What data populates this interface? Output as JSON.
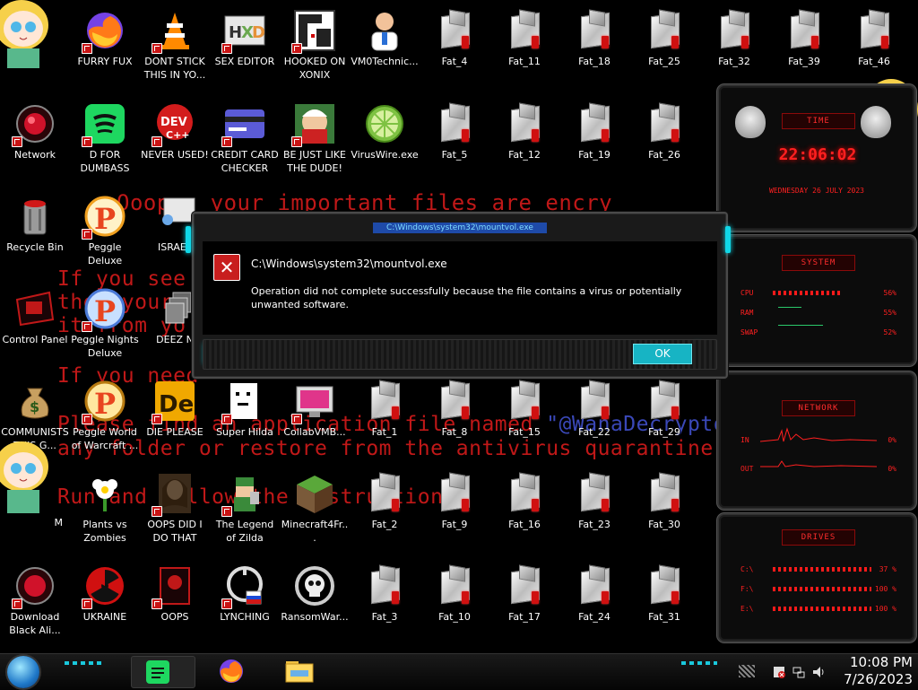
{
  "ransom_note": {
    "line1": "Ooops, your important files are encry",
    "line2": "If you see",
    "line3": "then your",
    "line4": "it from yo",
    "line5": "If you need",
    "line6_pre": "Please find an application file named ",
    "line6_highlight": "\"@WanaDecryptor",
    "line7": "any folder or restore from the antivirus quarantine.",
    "line8": "Run and follow the instructions!"
  },
  "desktop": {
    "icons": [
      {
        "label": "",
        "icon": "star-butterfly-icon"
      },
      {
        "label": "FURRY FUX",
        "icon": "firefox-icon"
      },
      {
        "label": "DONT STICK THIS IN YO...",
        "icon": "vlc-cone-icon"
      },
      {
        "label": "SEX EDITOR",
        "icon": "hxd-editor-icon"
      },
      {
        "label": "HOOKED ON XONIX",
        "icon": "xonix-game-icon"
      },
      {
        "label": "VM0Technic...",
        "icon": "doctor-icon"
      },
      {
        "label": "Network",
        "icon": "network-icon"
      },
      {
        "label": "D FOR DUMBASS",
        "icon": "spotify-icon"
      },
      {
        "label": "NEVER USED!",
        "icon": "devcpp-icon"
      },
      {
        "label": "CREDIT CARD CHECKER",
        "icon": "credit-card-icon"
      },
      {
        "label": "BE JUST LIKE THE DUDE!",
        "icon": "dude-icon"
      },
      {
        "label": "VirusWire.exe",
        "icon": "lime-icon"
      },
      {
        "label": "Recycle Bin",
        "icon": "recycle-bin-icon"
      },
      {
        "label": "Peggle Deluxe",
        "icon": "peggle-icon"
      },
      {
        "label": "ISRAEL",
        "icon": "israel-icon"
      },
      {
        "label": "Control Panel",
        "icon": "control-panel-icon"
      },
      {
        "label": "Peggle Nights Deluxe",
        "icon": "peggle-nights-icon"
      },
      {
        "label": "DEEZ N",
        "icon": "deez-icon"
      },
      {
        "label": "COMMUNISTS THIS G...",
        "icon": "money-bag-icon"
      },
      {
        "label": "Peggle World of Warcraft ...",
        "icon": "peggle-wow-icon"
      },
      {
        "label": "DIE PLEASE",
        "icon": "die-icon"
      },
      {
        "label": "Super Hilda",
        "icon": "hilda-icon"
      },
      {
        "label": "CollabVMB...",
        "icon": "collabvm-icon"
      },
      {
        "label": "M",
        "icon": "star-butterfly-icon"
      },
      {
        "label": "Plants vs Zombies",
        "icon": "pvz-icon"
      },
      {
        "label": "OOPS DID I DO THAT",
        "icon": "portrait-icon"
      },
      {
        "label": "The Legend of Zilda",
        "icon": "zilda-icon"
      },
      {
        "label": "Minecraft4Fr...",
        "icon": "minecraft-icon"
      },
      {
        "label": "Download Black Ali...",
        "icon": "alien-icon"
      },
      {
        "label": "UKRAINE",
        "icon": "radiation-icon"
      },
      {
        "label": "OOPS",
        "icon": "oops-icon"
      },
      {
        "label": "LYNCHING",
        "icon": "lynching-icon"
      },
      {
        "label": "RansomWar...",
        "icon": "skull-icon"
      }
    ],
    "fat_files": [
      "Fat_4",
      "Fat_11",
      "Fat_18",
      "Fat_25",
      "Fat_32",
      "Fat_39",
      "Fat_46",
      "Fat_5",
      "Fat_12",
      "Fat_19",
      "Fat_26",
      "Fat_1",
      "Fat_8",
      "Fat_15",
      "Fat_22",
      "Fat_29",
      "Fat_2",
      "Fat_9",
      "Fat_16",
      "Fat_23",
      "Fat_30",
      "Fat_3",
      "Fat_10",
      "Fat_17",
      "Fat_24",
      "Fat_31"
    ]
  },
  "rainmeter": {
    "time": {
      "title": "TIME",
      "clock": "22:06:02",
      "date": "WEDNESDAY 26 JULY 2023"
    },
    "system": {
      "title": "SYSTEM",
      "cpu_label": "CPU",
      "cpu_value": "56%",
      "ram_label": "RAM",
      "ram_value": "55%",
      "swap_label": "SWAP",
      "swap_value": "52%"
    },
    "network": {
      "title": "NETWORK",
      "in_label": "IN",
      "in_value": "0%",
      "out_label": "OUT",
      "out_value": "0%"
    },
    "drives": {
      "title": "DRIVES",
      "rows": [
        {
          "label": "C:\\",
          "value": "37 %"
        },
        {
          "label": "F:\\",
          "value": "100 %"
        },
        {
          "label": "E:\\",
          "value": "100 %"
        }
      ]
    }
  },
  "dialog": {
    "titlebar": "C:\\Windows\\system32\\mountvol.exe",
    "heading": "C:\\Windows\\system32\\mountvol.exe",
    "message": "Operation did not complete successfully because the file contains a virus or potentially unwanted software.",
    "ok_label": "OK"
  },
  "taskbar": {
    "clock_time": "10:08 PM",
    "clock_date": "7/26/2023"
  },
  "colors": {
    "ransom_red": "#c01818",
    "accent_cyan": "#17b4c4",
    "rainmeter_red": "#ff2020"
  }
}
